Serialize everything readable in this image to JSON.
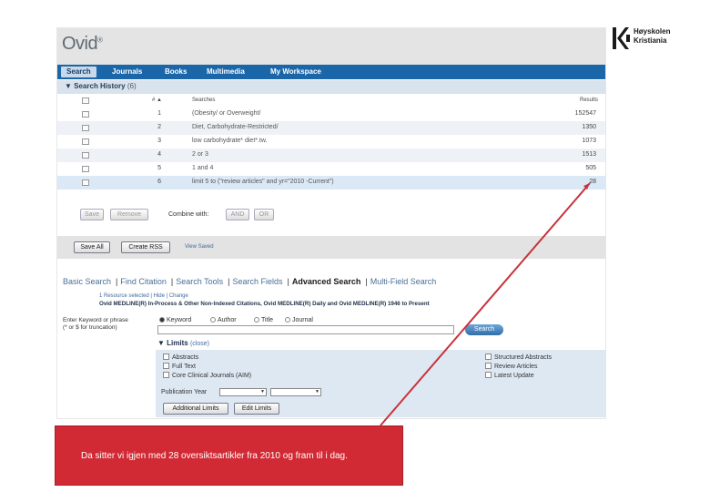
{
  "header": {
    "logo": "Ovid",
    "logo_mark": "®"
  },
  "nav": {
    "items": [
      "Search",
      "Journals",
      "Books",
      "Multimedia",
      "My Workspace"
    ]
  },
  "history": {
    "title": "Search History",
    "count": "(6)",
    "columns": {
      "num": "# ▲",
      "searches": "Searches",
      "results": "Results"
    },
    "rows": [
      {
        "num": "1",
        "search": "(Obesity/ or Overweight/",
        "results": "152547"
      },
      {
        "num": "2",
        "search": "Diet, Carbohydrate-Restricted/",
        "results": "1350"
      },
      {
        "num": "3",
        "search": "low carbohydrate* diet*.tw.",
        "results": "1073"
      },
      {
        "num": "4",
        "search": "2 or 3",
        "results": "1513"
      },
      {
        "num": "5",
        "search": "1 and 4",
        "results": "505"
      },
      {
        "num": "6",
        "search": "limit 5 to (\"review articles\" and yr=\"2010 -Current\")",
        "results": "28"
      }
    ]
  },
  "actions": {
    "save": "Save",
    "remove": "Remove",
    "combine_with": "Combine with:",
    "and": "AND",
    "or": "OR",
    "save_all": "Save All",
    "create_rss": "Create RSS",
    "view_saved": "View Saved"
  },
  "search_tabs": [
    "Basic Search",
    "Find Citation",
    "Search Tools",
    "Search Fields",
    "Advanced Search",
    "Multi-Field Search"
  ],
  "resource_line": "1 Resource selected | Hide | Change",
  "database_line": "Ovid MEDLINE(R) In-Process & Other Non-Indexed Citations, Ovid MEDLINE(R) Daily and Ovid MEDLINE(R) 1946 to Present",
  "keyword": {
    "label_line1": "Enter Keyword or phrase",
    "label_line2": "(* or $ for truncation)",
    "options": [
      "Keyword",
      "Author",
      "Title",
      "Journal"
    ],
    "search_button": "Search"
  },
  "limits": {
    "title": "Limits",
    "close": "(close)",
    "left": [
      "Abstracts",
      "Full Text",
      "Core Clinical Journals (AIM)"
    ],
    "right": [
      "Structured Abstracts",
      "Review Articles",
      "Latest Update"
    ],
    "publication_year": "Publication Year",
    "additional_limits": "Additional Limits",
    "edit_limits": "Edit Limits"
  },
  "callout": {
    "text": "Da sitter vi igjen med 28 oversiktsartikler fra 2010 og fram til i dag."
  },
  "brand": {
    "line1": "Høyskolen",
    "line2": "Kristiania"
  },
  "colors": {
    "nav": "#1a66a8",
    "callout": "#d12a34",
    "arrow": "#c9323c"
  }
}
